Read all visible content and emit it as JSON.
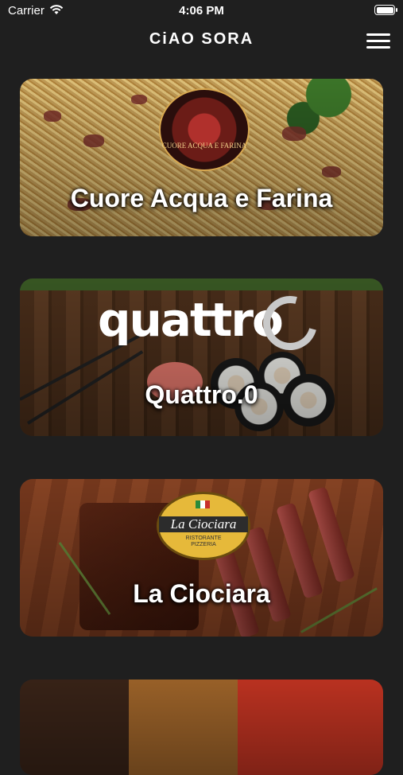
{
  "status_bar": {
    "carrier": "Carrier",
    "time": "4:06 PM"
  },
  "header": {
    "brand": "CiAO SORA",
    "menu_icon": "hamburger-menu-icon"
  },
  "restaurants": [
    {
      "name": "Cuore Acqua e Farina",
      "logo_text": "CUORE ACQUA E FARINA"
    },
    {
      "name": "Quattro.0",
      "logo_text": "quattro"
    },
    {
      "name": "La Ciociara",
      "logo_text": "La Ciociara",
      "logo_subtext_1": "RISTORANTE",
      "logo_subtext_2": "PIZZERIA"
    }
  ],
  "colors": {
    "background": "#1f1f1f",
    "text": "#ffffff"
  }
}
